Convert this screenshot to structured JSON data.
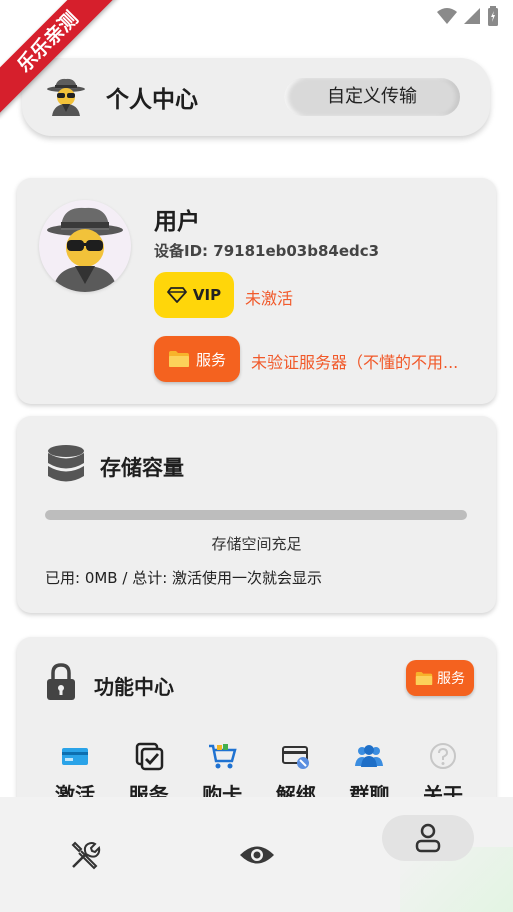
{
  "ribbon": {
    "text": "乐乐亲测"
  },
  "header": {
    "title": "个人中心",
    "action_label": "自定义传输"
  },
  "user": {
    "name": "用户",
    "device_id": "设备ID: 79181eb03b84edc3",
    "vip_label": "VIP",
    "vip_status": "未激活",
    "service_label": "服务",
    "service_status": "未验证服务器（不懂的不用..."
  },
  "storage": {
    "title": "存储容量",
    "used_fraction": 0,
    "note": "存储空间充足",
    "usage": "已用: 0MB / 总计: 激活使用一次就会显示"
  },
  "features": {
    "title": "功能中心",
    "badge_label": "服务",
    "items": [
      {
        "label": "激活",
        "icon": "card-icon"
      },
      {
        "label": "服务",
        "icon": "checklist-icon"
      },
      {
        "label": "购卡",
        "icon": "cart-icon"
      },
      {
        "label": "解绑",
        "icon": "unbind-icon"
      },
      {
        "label": "群聊",
        "icon": "group-icon"
      },
      {
        "label": "关于",
        "icon": "help-icon"
      }
    ]
  },
  "bottom_nav": {
    "items": [
      "tools-icon",
      "eye-icon",
      "person-icon"
    ],
    "active": "person-icon"
  },
  "colors": {
    "accent_orange": "#f4621f",
    "vip_yellow": "#ffd60a",
    "warning_text": "#f1592a",
    "ribbon_red": "#d61f2c"
  }
}
